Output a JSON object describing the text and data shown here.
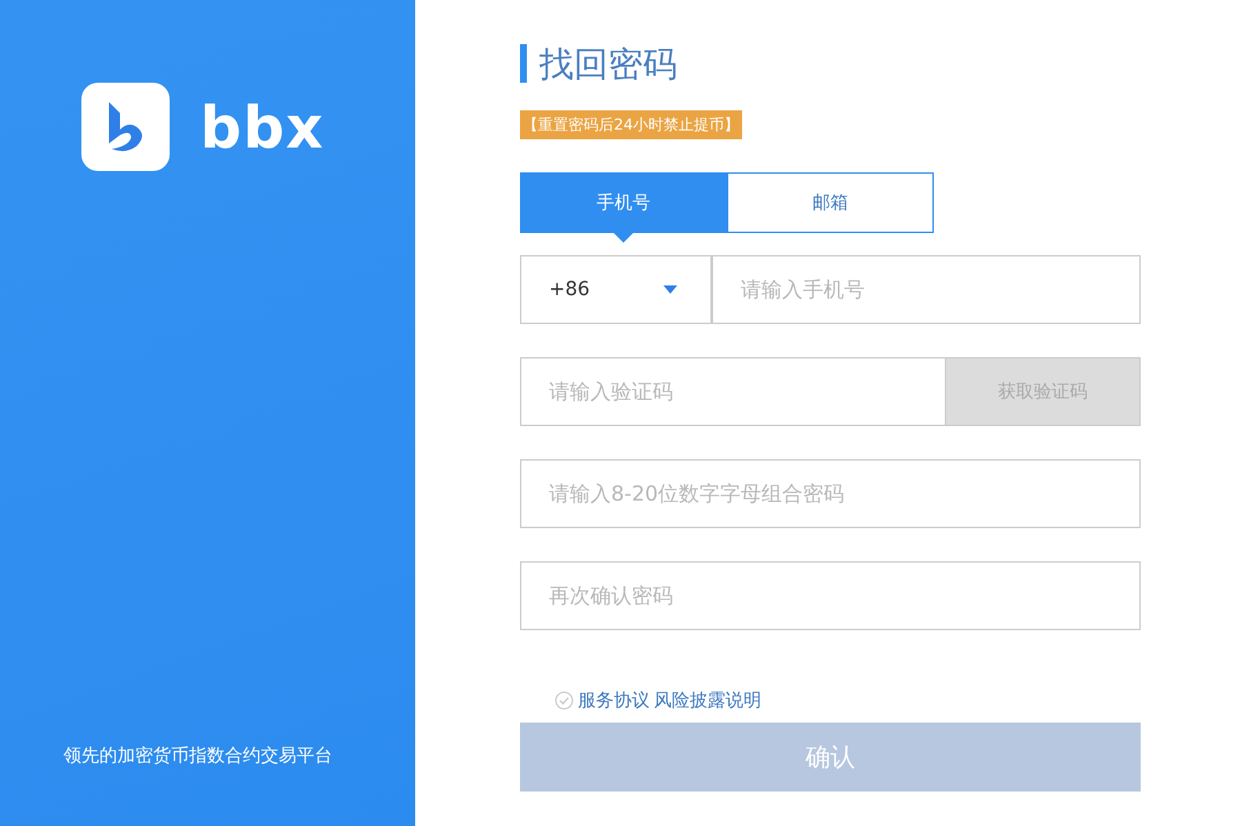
{
  "brand": {
    "name": "bbx",
    "tagline": "领先的加密货币指数合约交易平台"
  },
  "form": {
    "title": "找回密码",
    "notice": "【重置密码后24小时禁止提币】",
    "tabs": [
      {
        "label": "手机号",
        "selected": true
      },
      {
        "label": "邮箱",
        "selected": false
      }
    ],
    "country_code": "+86",
    "fields": [
      {
        "kind": "phone",
        "placeholder": "请输入手机号"
      },
      {
        "kind": "code",
        "placeholder": "请输入验证码",
        "button": "获取验证码"
      },
      {
        "kind": "plain",
        "placeholder": "请输入8-20位数字字母组合密码"
      },
      {
        "kind": "plain",
        "placeholder": "再次确认密码"
      }
    ],
    "agreement": {
      "checked": false,
      "links": [
        "服务协议",
        "风险披露说明"
      ]
    },
    "submit": {
      "label": "确认",
      "disabled": true
    }
  }
}
